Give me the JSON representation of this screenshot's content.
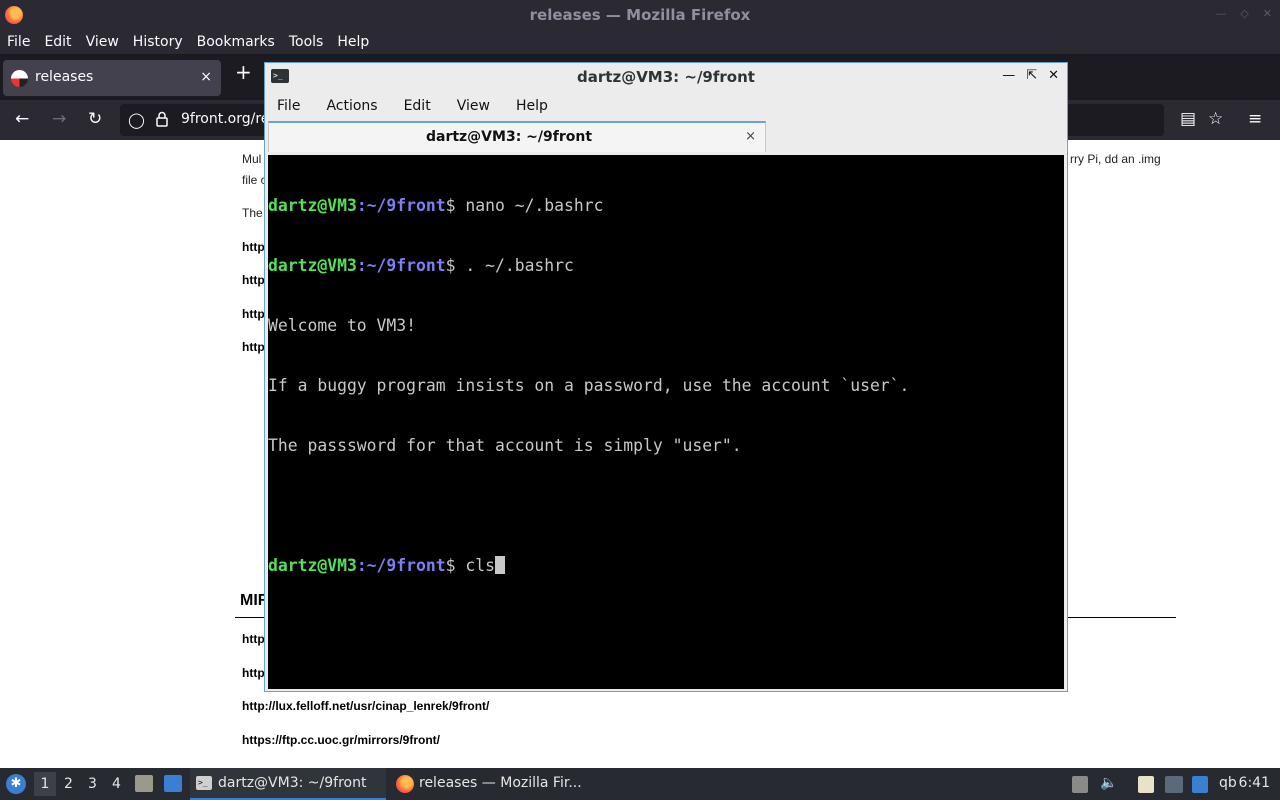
{
  "firefox": {
    "title": "releases — Mozilla Firefox",
    "menu": [
      "File",
      "Edit",
      "View",
      "History",
      "Bookmarks",
      "Tools",
      "Help"
    ],
    "tab_label": "releases",
    "tab_close": "×",
    "newtab": "+",
    "url": "9front.org/re",
    "page": {
      "frag1": "Mul",
      "frag2": "file c",
      "frag3": "rry Pi, dd an .img",
      "frag4": "The",
      "links_top": [
        "http",
        "http",
        "http",
        "http"
      ],
      "mirrors_heading": "MIR",
      "links_bottom_partial": [
        "http",
        "http"
      ],
      "links_bottom": [
        "http://lux.felloff.net/usr/cinap_lenrek/9front/",
        "https://ftp.cc.uoc.gr/mirrors/9front/"
      ]
    }
  },
  "terminal": {
    "title": "dartz@VM3: ~/9front",
    "menu": [
      "File",
      "Actions",
      "Edit",
      "View",
      "Help"
    ],
    "tab_label": "dartz@VM3: ~/9front",
    "tab_close": "×",
    "icon_glyph": ">_",
    "lines": [
      {
        "user": "dartz@VM3",
        "path": ":~/9front",
        "rest": "$ nano ~/.bashrc"
      },
      {
        "user": "dartz@VM3",
        "path": ":~/9front",
        "rest": "$ . ~/.bashrc"
      },
      {
        "text": "Welcome to VM3!"
      },
      {
        "text": "If a buggy program insists on a password, use the account `user`."
      },
      {
        "text": "The passsword for that account is simply \"user\"."
      },
      {
        "text": ""
      },
      {
        "user": "dartz@VM3",
        "path": ":~/9front",
        "rest": "$ cls"
      }
    ]
  },
  "taskbar": {
    "workspaces": [
      "1",
      "2",
      "3",
      "4"
    ],
    "tasks": [
      {
        "label": "dartz@VM3: ~/9front"
      },
      {
        "label": "releases — Mozilla Fir..."
      }
    ],
    "tray_text": "qb",
    "clock": "6:41"
  },
  "colors": {
    "prompt_user": "#55e05a",
    "prompt_path": "#7f7ff5",
    "terminal_bg": "#000000",
    "accent": "#3a7fd1"
  }
}
